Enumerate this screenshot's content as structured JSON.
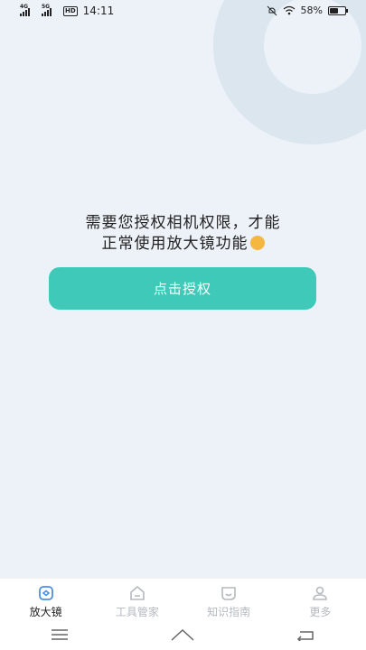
{
  "status_bar": {
    "net1_tag": "4G",
    "net2_tag": "5G",
    "hd_label": "HD",
    "time": "14:11",
    "battery_text": "58%",
    "battery_level": 0.58
  },
  "main": {
    "message_line1": "需要您授权相机权限，才能",
    "message_line2": "正常使用放大镜功能",
    "emoji_icon": "hand-pointing-down",
    "auth_button_label": "点击授权",
    "accent_color": "#3ec9b8"
  },
  "tab_bar": {
    "tabs": [
      {
        "label": "放大镜",
        "icon": "magnifier-icon",
        "active": true
      },
      {
        "label": "工具管家",
        "icon": "toolbox-icon",
        "active": false
      },
      {
        "label": "知识指南",
        "icon": "guide-icon",
        "active": false
      },
      {
        "label": "更多",
        "icon": "user-icon",
        "active": false
      }
    ]
  },
  "nav_bar": {
    "buttons": [
      "menu",
      "home",
      "back"
    ]
  }
}
